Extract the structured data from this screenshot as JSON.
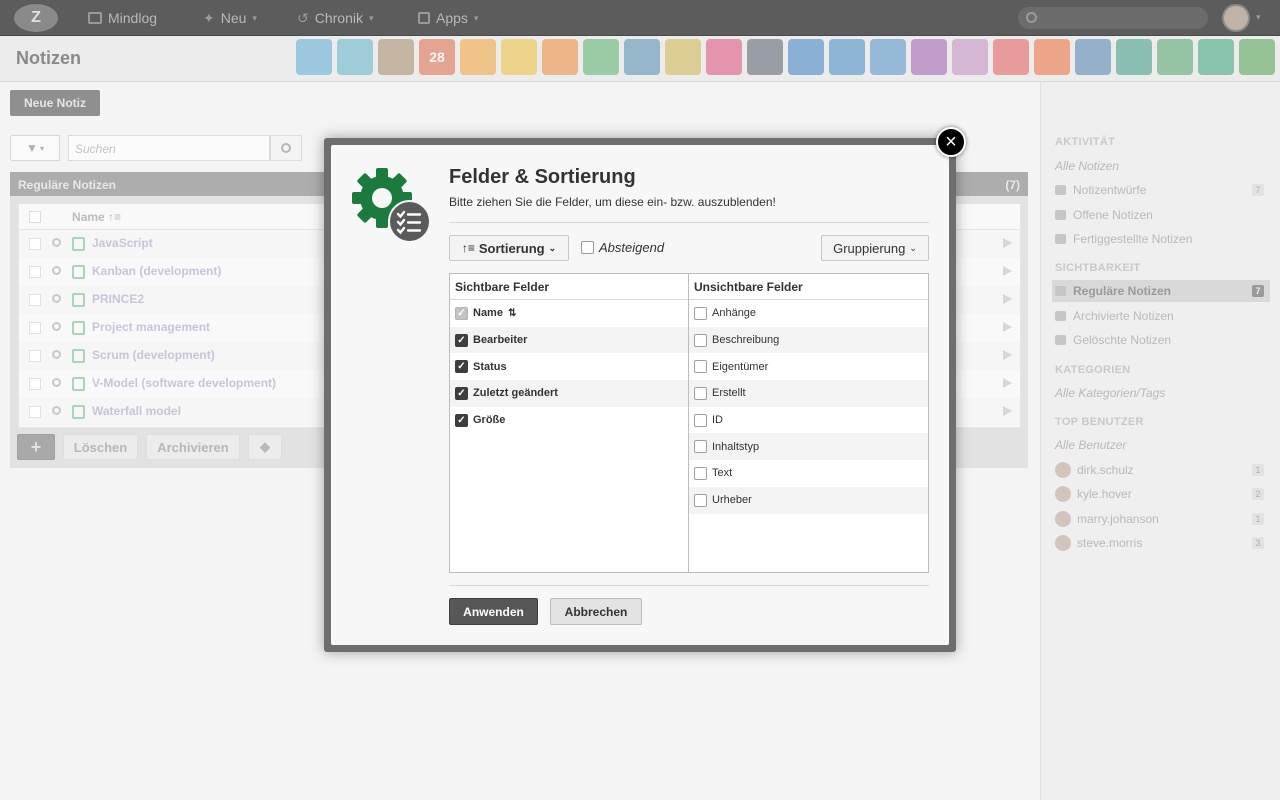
{
  "topbar": {
    "nav": [
      {
        "label": "Mindlog",
        "icon": "mindlog-icon",
        "chevron": false
      },
      {
        "label": "Neu",
        "icon": "plus-icon",
        "chevron": true
      },
      {
        "label": "Chronik",
        "icon": "history-icon",
        "chevron": true
      },
      {
        "label": "Apps",
        "icon": "apps-icon",
        "chevron": true
      }
    ]
  },
  "page": {
    "title": "Notizen",
    "new_note_label": "Neue Notiz",
    "search_placeholder": "Suchen"
  },
  "app_icons": [
    {
      "name": "email-icon",
      "color": "#5aa9d6"
    },
    {
      "name": "contacts-icon",
      "color": "#5fb3c8"
    },
    {
      "name": "address-book-icon",
      "color": "#a68b6a"
    },
    {
      "name": "calendar-icon",
      "color": "#e0684a",
      "text": "28"
    },
    {
      "name": "timer-icon",
      "color": "#f3a33b"
    },
    {
      "name": "tasks-icon",
      "color": "#f0c03b"
    },
    {
      "name": "checklist-icon",
      "color": "#ef8a3a"
    },
    {
      "name": "notes-icon",
      "color": "#57b46c"
    },
    {
      "name": "bookmark-icon",
      "color": "#4f8bb0"
    },
    {
      "name": "document-icon",
      "color": "#cdb54a"
    },
    {
      "name": "desk-icon",
      "color": "#e04d7c"
    },
    {
      "name": "dollar-icon",
      "color": "#555f6b"
    },
    {
      "name": "truck-icon",
      "color": "#3c7fc4"
    },
    {
      "name": "settings-icon",
      "color": "#3f88c4"
    },
    {
      "name": "money-bag-icon",
      "color": "#4f8ec9"
    },
    {
      "name": "contract-icon",
      "color": "#a05cb0"
    },
    {
      "name": "handshake-icon",
      "color": "#c28ac0"
    },
    {
      "name": "invoice-icon",
      "color": "#e35a5a"
    },
    {
      "name": "broadcast-icon",
      "color": "#ef6b3b"
    },
    {
      "name": "download-icon",
      "color": "#4e7fb0"
    },
    {
      "name": "cart-icon",
      "color": "#3d9a86"
    },
    {
      "name": "cash-icon",
      "color": "#52a26b"
    },
    {
      "name": "tag-icon",
      "color": "#3aa47a"
    },
    {
      "name": "database-icon",
      "color": "#4ea34e"
    }
  ],
  "panel": {
    "title": "Reguläre Notizen",
    "count": "(7)",
    "name_header": "Name",
    "rows": [
      "JavaScript",
      "Kanban (development)",
      "PRINCE2",
      "Project management",
      "Scrum (development)",
      "V-Model (software development)",
      "Waterfall model"
    ],
    "buttons": {
      "add": "+",
      "delete": "Löschen",
      "archive": "Archivieren"
    }
  },
  "sidebar": {
    "activity_header": "AKTIVITÄT",
    "all_notes": "Alle Notizen",
    "activity": [
      {
        "label": "Notizentwürfe",
        "count": "7",
        "icon": "sparkle-icon"
      },
      {
        "label": "Offene Notizen",
        "count": "",
        "icon": "alarm-icon"
      },
      {
        "label": "Fertiggestellte Notizen",
        "count": "",
        "icon": "stamp-icon"
      }
    ],
    "visibility_header": "SICHTBARKEIT",
    "visibility": [
      {
        "label": "Reguläre Notizen",
        "count": "7",
        "icon": "drawer-icon",
        "active": true
      },
      {
        "label": "Archivierte Notizen",
        "count": "",
        "icon": "archive-icon",
        "active": false
      },
      {
        "label": "Gelöschte Notizen",
        "count": "",
        "icon": "trash-icon",
        "active": false
      }
    ],
    "categories_header": "KATEGORIEN",
    "all_categories": "Alle Kategorien/Tags",
    "top_users_header": "TOP BENUTZER",
    "all_users": "Alle Benutzer",
    "users": [
      {
        "name": "dirk.schulz",
        "count": "1"
      },
      {
        "name": "kyle.hover",
        "count": "2"
      },
      {
        "name": "marry.johanson",
        "count": "1"
      },
      {
        "name": "steve.morris",
        "count": "3"
      }
    ]
  },
  "modal": {
    "title": "Felder & Sortierung",
    "subtitle": "Bitte ziehen Sie die Felder, um diese ein- bzw. auszublenden!",
    "sort_label": "Sortierung",
    "descending_label": "Absteigend",
    "descending_checked": false,
    "grouping_label": "Gruppierung",
    "visible_header": "Sichtbare Felder",
    "hidden_header": "Unsichtbare Felder",
    "visible_fields": [
      {
        "label": "Name",
        "checked": true,
        "disabled": true,
        "sort_icon": true
      },
      {
        "label": "Bearbeiter",
        "checked": true,
        "disabled": false
      },
      {
        "label": "Status",
        "checked": true,
        "disabled": false
      },
      {
        "label": "Zuletzt geändert",
        "checked": true,
        "disabled": false
      },
      {
        "label": "Größe",
        "checked": true,
        "disabled": false
      }
    ],
    "hidden_fields": [
      {
        "label": "Anhänge",
        "checked": false
      },
      {
        "label": "Beschreibung",
        "checked": false
      },
      {
        "label": "Eigentümer",
        "checked": false
      },
      {
        "label": "Erstellt",
        "checked": false
      },
      {
        "label": "ID",
        "checked": false
      },
      {
        "label": "Inhaltstyp",
        "checked": false
      },
      {
        "label": "Text",
        "checked": false
      },
      {
        "label": "Urheber",
        "checked": false
      }
    ],
    "apply_label": "Anwenden",
    "cancel_label": "Abbrechen",
    "accent_color": "#1b7a3e"
  }
}
